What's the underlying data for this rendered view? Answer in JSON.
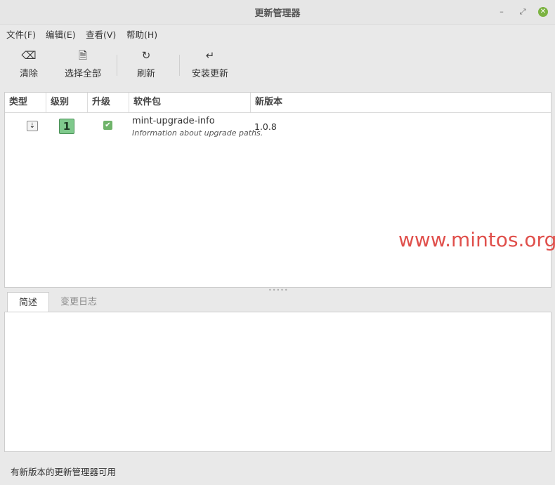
{
  "window": {
    "title": "更新管理器"
  },
  "menu": [
    "文件(F)",
    "编辑(E)",
    "查看(V)",
    "帮助(H)"
  ],
  "toolbar": {
    "clear": "清除",
    "select_all": "选择全部",
    "refresh": "刷新",
    "install": "安装更新"
  },
  "table": {
    "headers": [
      "类型",
      "级别",
      "升级",
      "软件包",
      "新版本"
    ],
    "rows": [
      {
        "level": "1",
        "package": "mint-upgrade-info",
        "description": "Information about upgrade paths.",
        "version": "1.0.8"
      }
    ]
  },
  "watermark": "www.mintos.org",
  "tabs": [
    "简述",
    "变更日志"
  ],
  "status": "有新版本的更新管理器可用",
  "icons": {
    "minimize": "minimize-icon",
    "restore": "restore-icon",
    "close": "close-icon",
    "clear": "backspace-icon",
    "select_all": "document-icon",
    "refresh": "refresh-icon",
    "install": "enter-icon",
    "type": "package-download-icon",
    "check": "checkbox-icon"
  },
  "colors": {
    "close_button": "#7cb342",
    "level_badge": "#7fc98c",
    "checkbox": "#6fb36a",
    "watermark": "#e0504c"
  }
}
